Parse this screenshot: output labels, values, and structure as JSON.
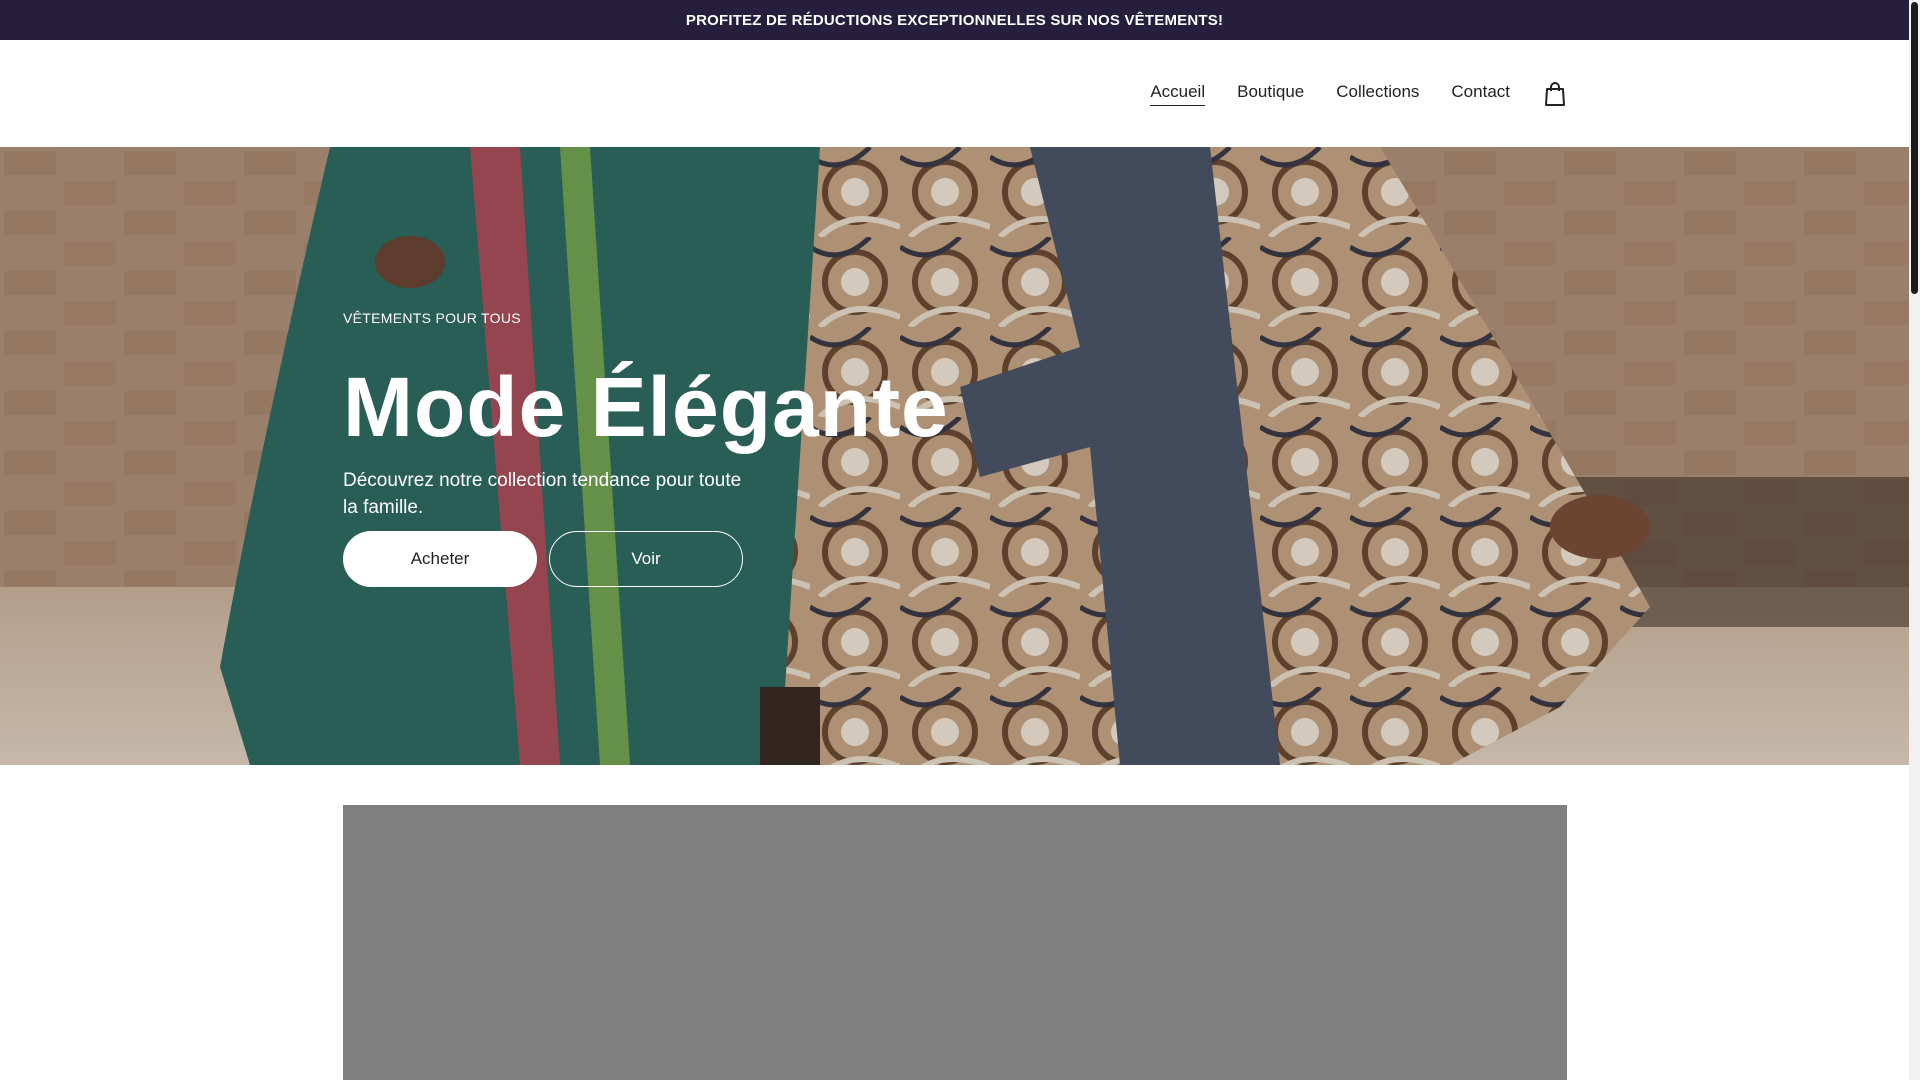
{
  "announcement": {
    "text": "PROFITEZ DE RÉDUCTIONS EXCEPTIONNELLES SUR NOS VÊTEMENTS!"
  },
  "nav": {
    "items": [
      {
        "label": "Accueil",
        "active": true
      },
      {
        "label": "Boutique",
        "active": false
      },
      {
        "label": "Collections",
        "active": false
      },
      {
        "label": "Contact",
        "active": false
      }
    ],
    "cart_icon": "shopping-bag-icon"
  },
  "hero": {
    "eyebrow": "VÊTEMENTS POUR TOUS",
    "title": "Mode Élégante",
    "subtitle": "Découvrez notre collection tendance pour toute la famille.",
    "primary_button": "Acheter",
    "secondary_button": "Voir"
  },
  "colors": {
    "announcement_bg": "#251f3d",
    "placeholder_gray": "#808080",
    "text_dark": "#222222"
  }
}
